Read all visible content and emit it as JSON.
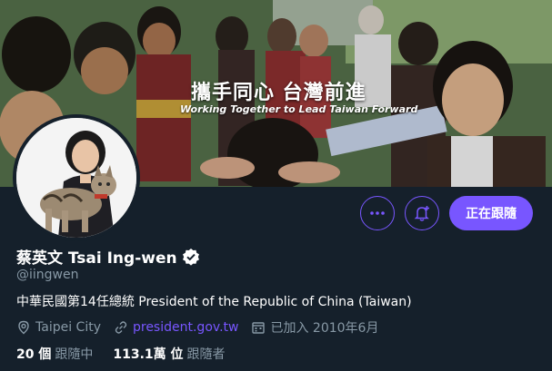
{
  "colors": {
    "background": "#15202b",
    "accent": "#7856ff",
    "muted": "#8899a6",
    "text": "#ffffff"
  },
  "banner": {
    "title": "攜手同心 台灣前進",
    "subtitle": "Working Together to Lead Taiwan Forward"
  },
  "actions": {
    "more_icon": "more-icon",
    "notify_icon": "notification-add-icon",
    "follow_label": "正在跟隨"
  },
  "profile": {
    "name": "蔡英文 Tsai Ing-wen",
    "verified_icon": "verified-badge-icon",
    "handle": "@iingwen",
    "bio": "中華民國第14任總統 President of the Republic of China (Taiwan)",
    "location": "Taipei City",
    "website": "president.gov.tw",
    "joined": "已加入 2010年6月"
  },
  "stats": {
    "following_count": "20 個",
    "following_label": "跟隨中",
    "followers_count": "113.1萬 位",
    "followers_label": "跟隨者"
  }
}
